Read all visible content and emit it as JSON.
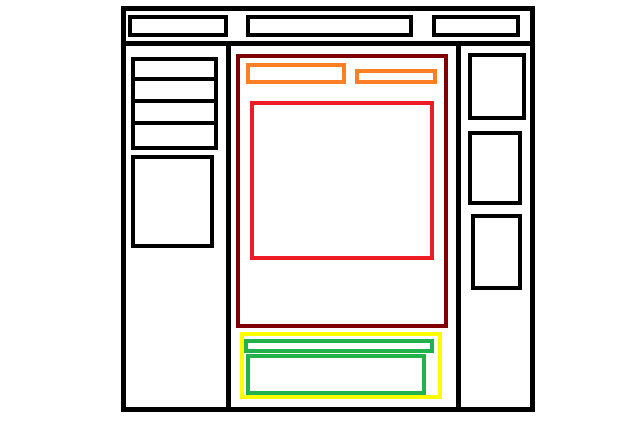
{
  "palette": {
    "outline": "#000000",
    "content_frame": "#800000",
    "header_strip": "#ff7f27",
    "content_block": "#ed1c24",
    "footer_frame": "#ffff00",
    "footer_bars": "#22b14c",
    "background": "#ffffff"
  }
}
